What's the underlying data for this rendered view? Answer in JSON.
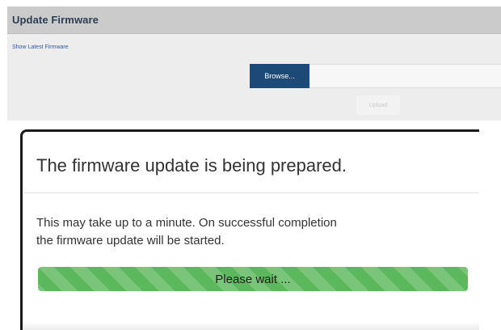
{
  "firmware_panel": {
    "title": "Update Firmware",
    "show_latest_link": "Show Latest Firmware",
    "browse_label": "Browse...",
    "file_value": "",
    "upload_label": "Upload"
  },
  "dialog": {
    "title": "The firmware update is being prepared.",
    "message_line1": "This may take up to a minute. On successful completion",
    "message_line2": "the firmware update will be started.",
    "progress": {
      "label": "Please wait ...",
      "value_percent": 100,
      "color": "#5cb85c",
      "striped": true
    }
  },
  "colors": {
    "header_bg": "#cbcbcb",
    "browse_button": "#1d4977",
    "link": "#2c5aa0"
  }
}
